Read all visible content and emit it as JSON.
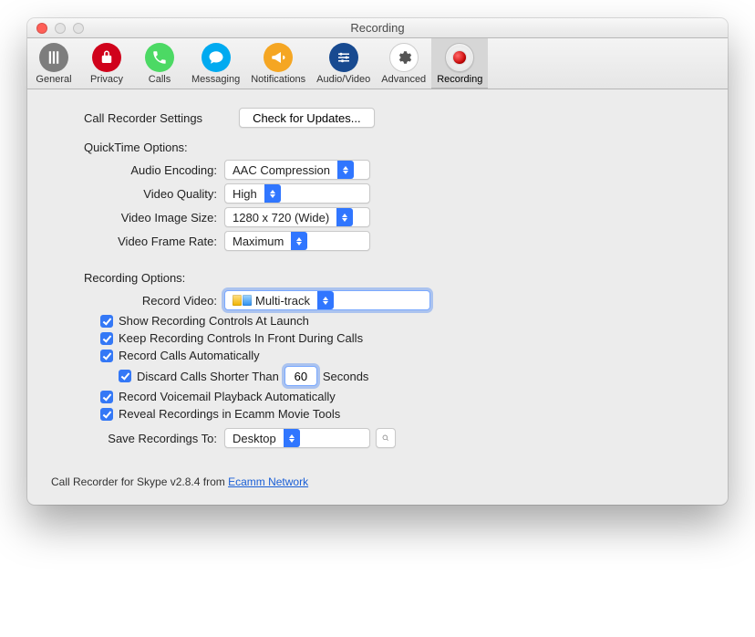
{
  "window": {
    "title": "Recording"
  },
  "toolbar": {
    "items": [
      {
        "key": "general",
        "label": "General"
      },
      {
        "key": "privacy",
        "label": "Privacy"
      },
      {
        "key": "calls",
        "label": "Calls"
      },
      {
        "key": "messaging",
        "label": "Messaging"
      },
      {
        "key": "notifications",
        "label": "Notifications"
      },
      {
        "key": "audiovideo",
        "label": "Audio/Video"
      },
      {
        "key": "advanced",
        "label": "Advanced"
      },
      {
        "key": "recording",
        "label": "Recording"
      }
    ],
    "active": "recording"
  },
  "settings": {
    "heading": "Call Recorder Settings",
    "update_button": "Check for Updates..."
  },
  "quicktime": {
    "heading": "QuickTime Options:",
    "audio_encoding": {
      "label": "Audio Encoding:",
      "value": "AAC Compression"
    },
    "video_quality": {
      "label": "Video Quality:",
      "value": "High"
    },
    "video_size": {
      "label": "Video Image Size:",
      "value": "1280 x 720 (Wide)"
    },
    "frame_rate": {
      "label": "Video Frame Rate:",
      "value": "Maximum"
    }
  },
  "recording": {
    "heading": "Recording Options:",
    "record_video": {
      "label": "Record Video:",
      "value": "Multi-track"
    },
    "show_controls_launch": {
      "label": "Show Recording Controls At Launch",
      "checked": true
    },
    "keep_front": {
      "label": "Keep Recording Controls In Front During Calls",
      "checked": true
    },
    "record_auto": {
      "label": "Record Calls Automatically",
      "checked": true
    },
    "discard_short": {
      "label_pre": "Discard Calls Shorter Than",
      "value": "60",
      "label_post": "Seconds",
      "checked": true
    },
    "record_voicemail": {
      "label": "Record Voicemail Playback Automatically",
      "checked": true
    },
    "reveal_tools": {
      "label": "Reveal Recordings in Ecamm Movie Tools",
      "checked": true
    },
    "save_to": {
      "label": "Save Recordings To:",
      "value": "Desktop"
    }
  },
  "footer": {
    "text_pre": "Call Recorder for Skype v2.8.4 from ",
    "link_text": "Ecamm Network"
  }
}
